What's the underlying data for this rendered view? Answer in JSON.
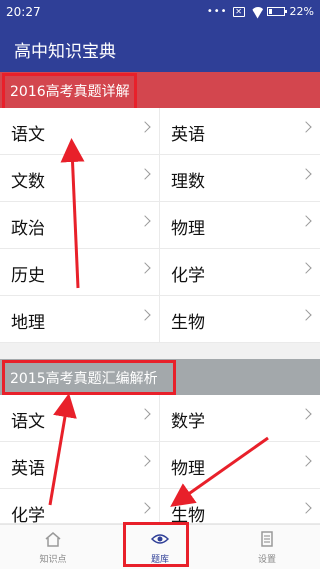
{
  "status_bar": {
    "time": "20:27",
    "dots": "•••",
    "sim_mark": "✕",
    "battery": "22%",
    "battery_level": 0.22
  },
  "app_bar": {
    "title": "高中知识宝典"
  },
  "sections": [
    {
      "title": "2016高考真题详解",
      "color": "#d3464e",
      "subjects": [
        "语文",
        "英语",
        "文数",
        "理数",
        "政治",
        "物理",
        "历史",
        "化学",
        "地理",
        "生物"
      ]
    },
    {
      "title": "2015高考真题汇编解析",
      "color": "#a3a8ab",
      "subjects": [
        "语文",
        "数学",
        "英语",
        "物理",
        "化学",
        "生物"
      ]
    }
  ],
  "tabs": [
    {
      "label": "知识点",
      "icon": "home-icon",
      "active": false
    },
    {
      "label": "题库",
      "icon": "eye-icon",
      "active": true
    },
    {
      "label": "设置",
      "icon": "document-icon",
      "active": false
    }
  ],
  "colors": {
    "primary": "#2f3f97",
    "highlight": "#e8202a"
  }
}
